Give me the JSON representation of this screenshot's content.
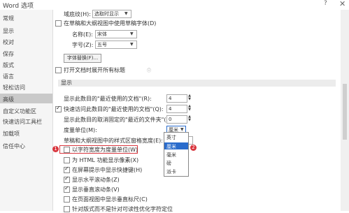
{
  "window": {
    "title": "Word 选项",
    "help_icon": "?",
    "close_icon": "✕"
  },
  "sidebar": {
    "items": [
      "常规",
      "显示",
      "校对",
      "保存",
      "版式",
      "语言",
      "轻松访问",
      "高级",
      "自定义功能区",
      "快速访问工具栏",
      "加载项",
      "信任中心"
    ],
    "selected": "高级"
  },
  "top": {
    "style_area_label": "域底纹(H):",
    "style_area_value": "选取时显示",
    "draft_font_label": "在草稿和大纲视图中使用草稿字体(D)",
    "name_label": "名称(E):",
    "name_value": "宋体",
    "size_label": "字号(Z):",
    "size_value": "五号",
    "font_sub_button": "字体替换(F)...",
    "expand_headings_label": "打开文档时展开所有标题",
    "info_icon": "ⓘ"
  },
  "display": {
    "section_title": "显示",
    "recent_docs_label": "显示此数目的\"最近使用的文档\"(R):",
    "recent_docs_value": "4",
    "quick_access_label": "快速访问此数目的\"最近使用的文档\"(Q):",
    "quick_access_value": "4",
    "unpinned_folders_label": "显示此数目的取消固定的\"最近的文件夹\"(F):",
    "unpinned_folders_value": "0",
    "units_label": "度量单位(M):",
    "units_value": "厘米",
    "units_options": [
      "英寸",
      "厘米",
      "毫米",
      "磅",
      "派卡"
    ],
    "style_width_label": "草稿和大纲视图中的样式区窗格宽度(E):",
    "char_width_label": "以字符宽度为度量单位(W)",
    "html_pixels_label": "为 HTML 功能显示像素(X)",
    "shortcut_keys_label": "在屏幕提示中显示快捷键(H)",
    "h_scroll_label": "显示水平滚动条(Z)",
    "v_scroll_label": "显示垂直滚动条(V)",
    "ruler_label": "在页面视图中显示垂直标尺(C)",
    "optimize_label": "针对版式而不是针对可读性优化字符定位",
    "badge1": "1",
    "badge2": "2"
  },
  "colors": {
    "accent": "#2a6ccc",
    "highlight": "#d9363e",
    "sidebar_selected": "#c9c9c9"
  }
}
